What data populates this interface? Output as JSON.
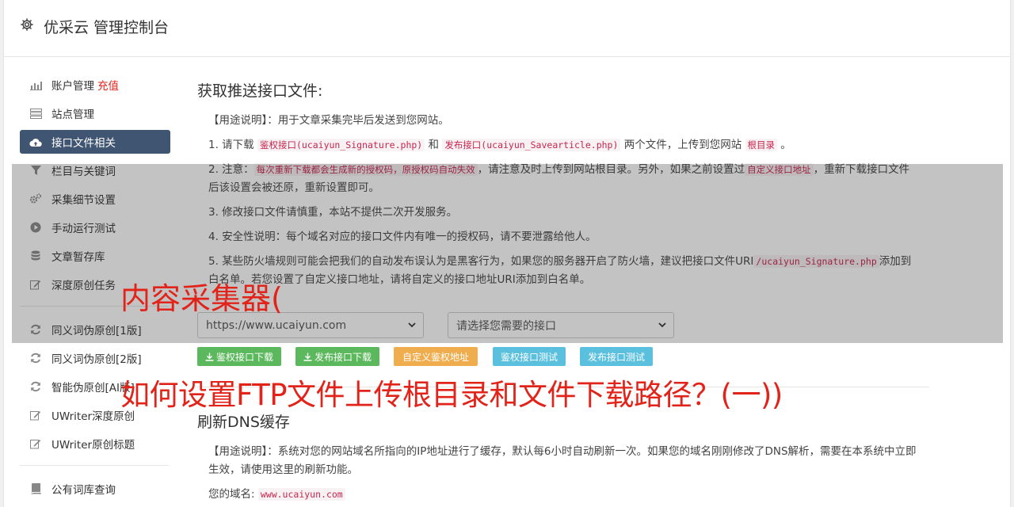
{
  "header": {
    "title": "优采云 管理控制台",
    "icon": "gear-icon"
  },
  "sidebar": {
    "account": {
      "label": "账户管理",
      "recharge": "充值"
    },
    "items": [
      {
        "label": "站点管理",
        "icon": "server-icon"
      },
      {
        "label": "接口文件相关",
        "icon": "cloud-upload-icon",
        "active": true
      },
      {
        "label": "栏目与关键词",
        "icon": "filter-icon"
      },
      {
        "label": "采集细节设置",
        "icon": "cogs-icon"
      },
      {
        "label": "手动运行测试",
        "icon": "play-icon"
      },
      {
        "label": "文章暂存库",
        "icon": "database-icon"
      },
      {
        "label": "深度原创任务",
        "icon": "edit-icon"
      }
    ],
    "items2": [
      {
        "label": "同义词伪原创[1版]",
        "icon": "refresh-icon"
      },
      {
        "label": "同义词伪原创[2版]",
        "icon": "refresh-icon"
      },
      {
        "label": "智能伪原创[AI版]",
        "icon": "refresh-icon"
      },
      {
        "label": "UWriter深度原创",
        "icon": "edit-icon"
      },
      {
        "label": "UWriter原创标题",
        "icon": "edit-icon"
      }
    ],
    "items3": [
      {
        "label": "公有词库查询",
        "icon": "book-icon"
      }
    ]
  },
  "section1": {
    "title": "获取推送接口文件:",
    "usage": "【用途说明】：用于文章采集完毕后发送到您网站。",
    "step1": {
      "a": "1. 请下载",
      "code1": "鉴权接口(ucaiyun_Signature.php)",
      "b": "和",
      "code2": "发布接口(ucaiyun_Savearticle.php)",
      "c": "两个文件，上传到您网站",
      "code3": "根目录",
      "d": "。"
    },
    "step2": {
      "a": "2. 注意：",
      "code1": "每次重新下载都会生成新的授权码，原授权码自动失效",
      "b": "，请注意及时上传到网站根目录。另外，如果之前设置过",
      "code2": "自定义接口地址",
      "c": "，重新下载接口文件后该设置会被还原，重新设置即可。"
    },
    "step3": "3. 修改接口文件请慎重，本站不提供二次开发服务。",
    "step4": "4. 安全性说明：每个域名对应的接口文件内有唯一的授权码，请不要泄露给他人。",
    "step5": {
      "a": "5. 某些防火墙规则可能会把我们的自动发布误认为是黑客行为，如果您的服务器开启了防火墙，建议把接口文件URI",
      "code1": "/ucaiyun_Signature.php",
      "b": "添加到白名单。若您设置了自定义接口地址，请将自定义的接口地址URI添加到白名单。"
    },
    "domain_select": "https://www.ucaiyun.com",
    "api_select": "请选择您需要的接口",
    "buttons": {
      "download_sign": "鉴权接口下载",
      "download_publish": "发布接口下载",
      "custom_sign": "自定义鉴权地址",
      "test_sign": "鉴权接口测试",
      "test_publish": "发布接口测试"
    }
  },
  "section2": {
    "title": "刷新DNS缓存",
    "usage": "【用途说明】：系统对您的网站域名所指向的IP地址进行了缓存，默认每6小时自动刷新一次。如果您的域名刚刚修改了DNS解析，需要在本系统中立即生效，请使用这里的刷新功能。",
    "domain_label": "您的域名:",
    "domain_value": "www.ucaiyun.com"
  },
  "overlay_text": {
    "line1": "内容采集器(",
    "line2": "如何设置FTP文件上传根目录和文件下载路径？(一))"
  },
  "colors": {
    "accent": "#3f5571",
    "red": "#e2231a",
    "green": "#5cb85c",
    "orange": "#f0ad4e",
    "blue": "#5bc0de"
  }
}
